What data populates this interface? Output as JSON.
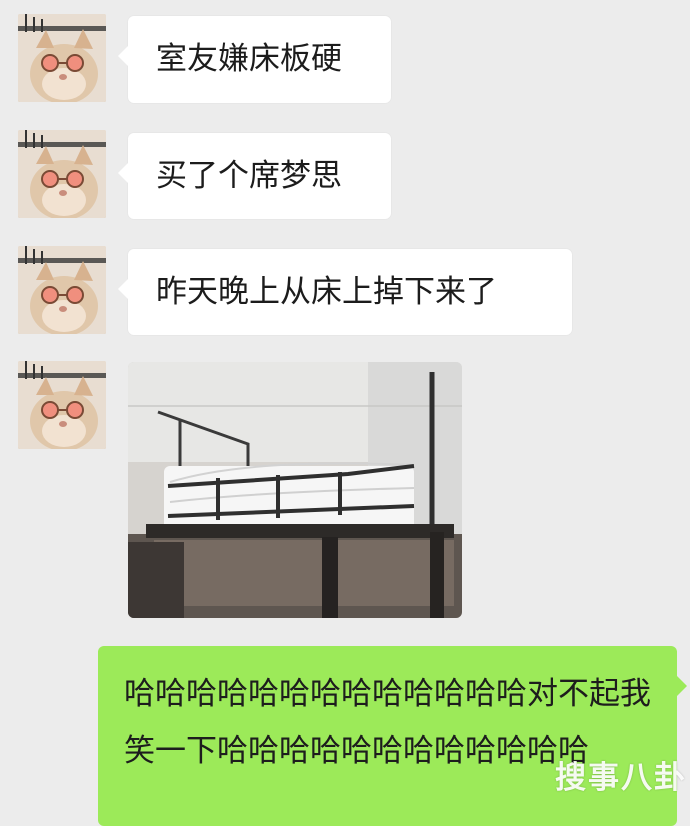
{
  "messages": [
    {
      "text": "室友嫌床板硬"
    },
    {
      "text": "买了个席梦思"
    },
    {
      "text": "昨天晚上从床上掉下来了"
    }
  ],
  "reply": {
    "text": "哈哈哈哈哈哈哈哈哈哈哈哈哈对不起我笑一下哈哈哈哈哈哈哈哈哈哈哈哈"
  },
  "watermark": {
    "text": "搜事八卦"
  },
  "avatar": {
    "icon": "cat-with-sunglasses-icon"
  },
  "photo": {
    "icon": "mattress-on-bunk-bed-photo"
  }
}
